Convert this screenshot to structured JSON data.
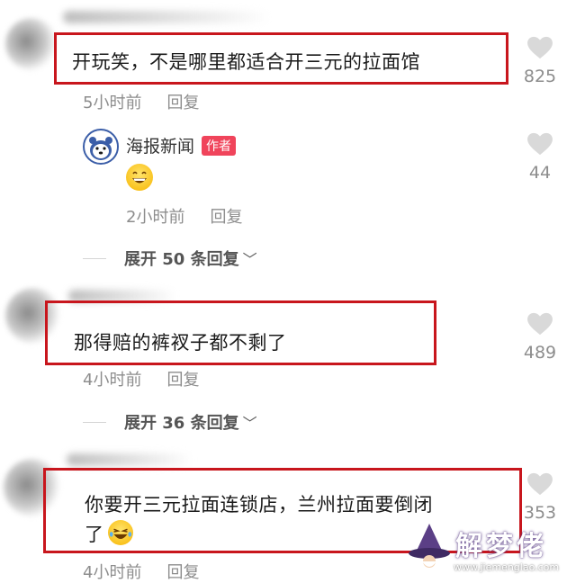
{
  "comments": [
    {
      "text": "开玩笑，不是哪里都适合开三元的拉面馆",
      "time": "5小时前",
      "reply_label": "回复",
      "likes": "825",
      "expand_label": "展开 50 条回复"
    },
    {
      "text": "那得赔的裤衩子都不剩了",
      "time": "4小时前",
      "reply_label": "回复",
      "likes": "489",
      "expand_label": "展开 36 条回复"
    },
    {
      "text_line1": "你要开三元拉面连锁店，兰州拉面要倒闭",
      "text_line2": "了",
      "time": "4小时前",
      "reply_label": "回复",
      "likes": "353"
    }
  ],
  "reply": {
    "author": "海报新闻",
    "badge": "作者",
    "time": "2小时前",
    "reply_label": "回复",
    "likes": "44"
  },
  "watermark": {
    "title": "解梦佬",
    "url": "www.jiemenglao.com"
  },
  "colors": {
    "highlight": "#c8161d",
    "author_badge": "#f0445b",
    "meta_text": "#8d8d8d"
  }
}
